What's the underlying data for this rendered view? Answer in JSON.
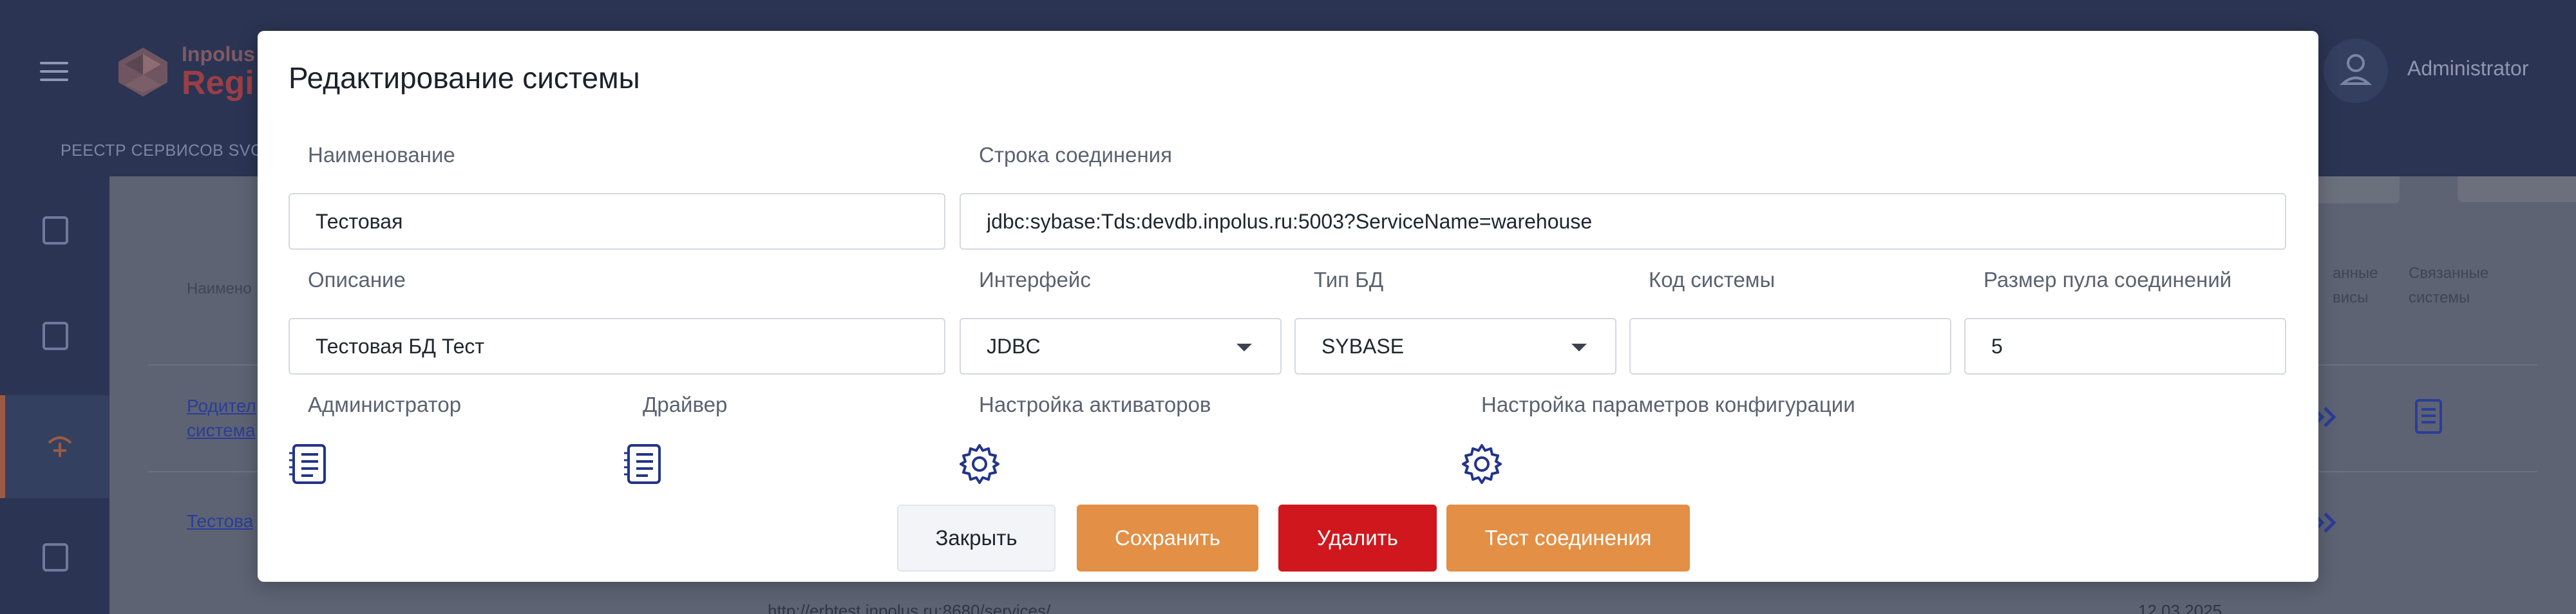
{
  "app": {
    "brand_line1": "Inpolus",
    "brand_line2": "Regi",
    "user_name": "Administrator",
    "nav_tab": "РЕЕСТР СЕРВИСОВ SVC",
    "colors": {
      "header_bg": "#2b3453",
      "accent_orange": "#e38f45",
      "danger_red": "#d0171d",
      "link_blue": "#2a3d9a"
    }
  },
  "background_table": {
    "col_name_header": "Наимено",
    "col_services_header": [
      "анные",
      "висы"
    ],
    "col_related_header": [
      "Связанные",
      "системы"
    ],
    "row1_link": [
      "Родител",
      "система"
    ],
    "row2_link": "Тестова",
    "footer_url": "http://erbtest.inpolus.ru:8680/services/",
    "footer_date": "12.03.2025"
  },
  "modal": {
    "title": "Редактирование системы",
    "fields": {
      "name": {
        "label": "Наименование",
        "value": "Тестовая"
      },
      "connection_string": {
        "label": "Строка соединения",
        "value": "jdbc:sybase:Tds:devdb.inpolus.ru:5003?ServiceName=warehouse"
      },
      "description": {
        "label": "Описание",
        "value": "Тестовая БД Тест"
      },
      "interface": {
        "label": "Интерфейс",
        "value": "JDBC"
      },
      "db_type": {
        "label": "Тип БД",
        "value": "SYBASE"
      },
      "system_code": {
        "label": "Код системы",
        "value": ""
      },
      "pool_size": {
        "label": "Размер пула соединений",
        "value": "5"
      }
    },
    "sections": {
      "administrator": {
        "label": "Администратор",
        "icon": "list-document-icon"
      },
      "driver": {
        "label": "Драйвер",
        "icon": "list-document-icon"
      },
      "activators": {
        "label": "Настройка активаторов",
        "icon": "gear-icon"
      },
      "config_params": {
        "label": "Настройка параметров конфигурации",
        "icon": "gear-icon"
      }
    },
    "buttons": {
      "close": "Закрыть",
      "save": "Сохранить",
      "delete": "Удалить",
      "test_connection": "Тест соединения"
    }
  }
}
